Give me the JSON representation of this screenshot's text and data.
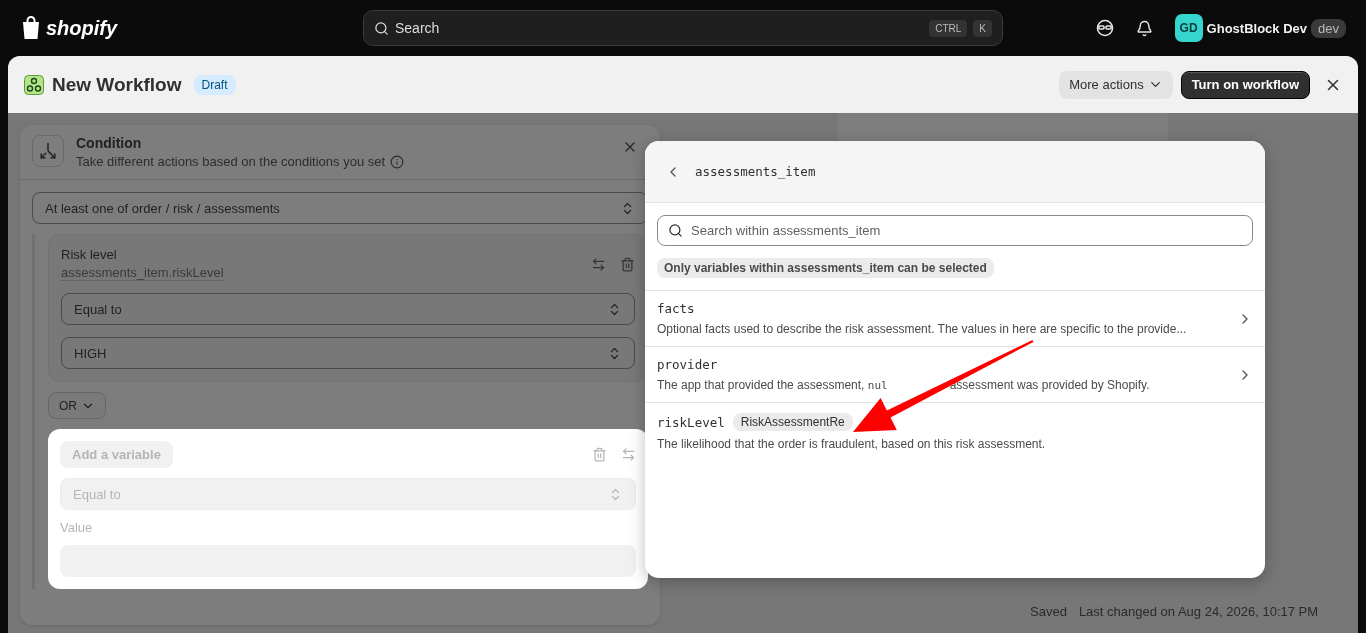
{
  "top_bar": {
    "logo": "shopify",
    "search": {
      "placeholder": "Search",
      "keys": [
        "CTRL",
        "K"
      ]
    },
    "user": {
      "initials": "GD",
      "name": "GhostBlock Dev",
      "badge": "dev"
    }
  },
  "header": {
    "title": "New Workflow",
    "badge": "Draft",
    "buttons": [
      {
        "label": "More actions",
        "kind": "menu"
      },
      {
        "label": "Turn on workflow",
        "kind": "primary"
      }
    ]
  },
  "condition": {
    "title": "Condition",
    "subtitle": "Take different actions based on the conditions you set",
    "scope": "At least one of order / risk / assessments",
    "rules": [
      {
        "label": "Risk level",
        "variable": "assessments_item.riskLevel",
        "operator": "Equal to",
        "value": "HIGH"
      }
    ],
    "joiner": "OR",
    "new_rule": {
      "variable_placeholder": "Add a variable",
      "operator": "Equal to",
      "value_label": "Value"
    }
  },
  "picker": {
    "title": "assessments_item",
    "search_placeholder": "Search within assessments_item",
    "hint": "Only variables within assessments_item can be selected",
    "items": [
      {
        "name": "facts",
        "has_children": true,
        "description": [
          {
            "text": "Optional facts used to describe the risk assessment. The values in here are specific to the provide...",
            "code": false
          }
        ]
      },
      {
        "name": "provider",
        "has_children": true,
        "description": [
          {
            "text": "The app that provided the assessment, ",
            "code": false
          },
          {
            "text": "nul",
            "code": true
          },
          {
            "text": "assessment was provided by Shopify.",
            "code": false
          }
        ]
      },
      {
        "name": "riskLevel",
        "type": "RiskAssessmentRe",
        "has_children": false,
        "description": [
          {
            "text": "The likelihood that the order is fraudulent, based on this risk assessment.",
            "code": false
          }
        ]
      }
    ]
  },
  "status": {
    "state": "Saved",
    "last_changed": "Last changed on Aug 24, 2026, 10:17 PM"
  }
}
